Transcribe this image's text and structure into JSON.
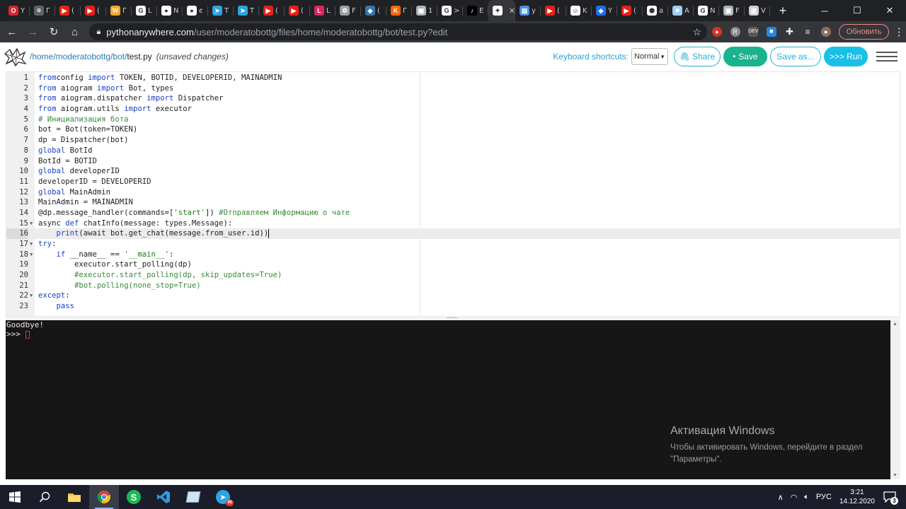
{
  "browser": {
    "tabs": [
      {
        "icon": "opera-icon",
        "color": "#d7262c",
        "glyph": "O",
        "text": "Y"
      },
      {
        "icon": "generic-tab-icon",
        "color": "#5f6368",
        "glyph": "⌾",
        "text": "Г"
      },
      {
        "icon": "youtube-icon",
        "color": "#e62117",
        "glyph": "▶",
        "text": "("
      },
      {
        "icon": "youtube-icon",
        "color": "#e62117",
        "glyph": "▶",
        "text": "("
      },
      {
        "icon": "wix-icon",
        "color": "#f5a623",
        "glyph": "W",
        "text": "Г"
      },
      {
        "icon": "google-icon",
        "color": "#ffffff",
        "glyph": "G",
        "text": "L"
      },
      {
        "icon": "github-icon",
        "color": "#ffffff",
        "glyph": "●",
        "text": "N"
      },
      {
        "icon": "github-icon",
        "color": "#ffffff",
        "glyph": "●",
        "text": "є"
      },
      {
        "icon": "telegram-icon",
        "color": "#2ca5e0",
        "glyph": "➤",
        "text": "T"
      },
      {
        "icon": "telegram-icon",
        "color": "#2ca5e0",
        "glyph": "➤",
        "text": "T"
      },
      {
        "icon": "youtube-icon",
        "color": "#e62117",
        "glyph": "▶",
        "text": "("
      },
      {
        "icon": "youtube-icon",
        "color": "#e62117",
        "glyph": "▶",
        "text": "("
      },
      {
        "icon": "lms-icon",
        "color": "#e0245e",
        "glyph": "L",
        "text": "L"
      },
      {
        "icon": "generic-tab-icon",
        "color": "#9aa0a6",
        "glyph": "⚙",
        "text": "F"
      },
      {
        "icon": "python-icon",
        "color": "#3776ab",
        "glyph": "◆",
        "text": "("
      },
      {
        "icon": "kinopoisk-icon",
        "color": "#ff6600",
        "glyph": "K",
        "text": "Г"
      },
      {
        "icon": "generic-tab-icon",
        "color": "#b0b3b8",
        "glyph": "▣",
        "text": "1"
      },
      {
        "icon": "google-icon",
        "color": "#ffffff",
        "glyph": "G",
        "text": ">"
      },
      {
        "icon": "tiktok-icon",
        "color": "#000000",
        "glyph": "♪",
        "text": "E"
      },
      {
        "icon": "pythonanywhere-icon",
        "color": "#ffffff",
        "glyph": "✦",
        "text": "",
        "active": true,
        "close": "✕"
      },
      {
        "icon": "generic-tab-icon",
        "color": "#4a90e2",
        "glyph": "▤",
        "text": "y"
      },
      {
        "icon": "youtube-icon",
        "color": "#e62117",
        "glyph": "▶",
        "text": "("
      },
      {
        "icon": "generic-tab-icon",
        "color": "#ffffff",
        "glyph": "☺",
        "text": "K"
      },
      {
        "icon": "generic-tab-icon",
        "color": "#1d6ff2",
        "glyph": "◈",
        "text": "Y"
      },
      {
        "icon": "youtube-icon",
        "color": "#e62117",
        "glyph": "▶",
        "text": "("
      },
      {
        "icon": "generic-tab-icon",
        "color": "#ffffff",
        "glyph": "⬢",
        "text": "a"
      },
      {
        "icon": "generic-tab-icon",
        "color": "#9bd0f0",
        "glyph": "✷",
        "text": "A"
      },
      {
        "icon": "google-icon",
        "color": "#ffffff",
        "glyph": "G",
        "text": "N"
      },
      {
        "icon": "generic-tab-icon",
        "color": "#b0b3b8",
        "glyph": "▣",
        "text": "F"
      },
      {
        "icon": "generic-tab-icon",
        "color": "#cfcfcf",
        "glyph": "▥",
        "text": "V"
      }
    ],
    "new_tab": "+",
    "url_host": "pythonanywhere.com",
    "url_path": "/user/moderatobottg/files/home/moderatobottg/bot/test.py?edit",
    "update_button": "Обновить"
  },
  "editor_header": {
    "path_link": "/home/moderatobottg/bot/",
    "file_name": "test.py",
    "unsaved": "(unsaved changes)",
    "keyboard_label": "Keyboard shortcuts:",
    "keyboard_mode": "Normal",
    "share": "Share",
    "save": "Save",
    "save_as": "Save as...",
    "run": ">>> Run"
  },
  "code_lines": [
    {
      "n": "1",
      "tokens": [
        [
          "kw",
          "from"
        ],
        [
          "",
          "config "
        ],
        [
          "kw",
          "import"
        ],
        [
          "",
          " TOKEN, BOTID, DEVELOPERID, MAINADMIN"
        ]
      ]
    },
    {
      "n": "2",
      "tokens": [
        [
          "kw",
          "from"
        ],
        [
          "",
          " aiogram "
        ],
        [
          "kw",
          "import"
        ],
        [
          "",
          " Bot, types"
        ]
      ]
    },
    {
      "n": "3",
      "tokens": [
        [
          "kw",
          "from"
        ],
        [
          "",
          " aiogram.dispatcher "
        ],
        [
          "kw",
          "import"
        ],
        [
          "",
          " Dispatcher"
        ]
      ]
    },
    {
      "n": "4",
      "tokens": [
        [
          "kw",
          "from"
        ],
        [
          "",
          " aiogram.utils "
        ],
        [
          "kw",
          "import"
        ],
        [
          "",
          " executor"
        ]
      ]
    },
    {
      "n": "5",
      "tokens": [
        [
          "cm",
          "# Инициализация бота"
        ]
      ]
    },
    {
      "n": "6",
      "tokens": [
        [
          "",
          "bot = Bot(token=TOKEN)"
        ]
      ]
    },
    {
      "n": "7",
      "tokens": [
        [
          "",
          "dp = Dispatcher(bot)"
        ]
      ]
    },
    {
      "n": "8",
      "tokens": [
        [
          "kw",
          "global"
        ],
        [
          "",
          " BotId"
        ]
      ]
    },
    {
      "n": "9",
      "tokens": [
        [
          "",
          "BotId = BOTID"
        ]
      ]
    },
    {
      "n": "10",
      "tokens": [
        [
          "kw",
          "global"
        ],
        [
          "",
          " developerID"
        ]
      ]
    },
    {
      "n": "11",
      "tokens": [
        [
          "",
          "developerID = DEVELOPERID"
        ]
      ]
    },
    {
      "n": "12",
      "tokens": [
        [
          "kw",
          "global"
        ],
        [
          "",
          " MainAdmin"
        ]
      ]
    },
    {
      "n": "13",
      "tokens": [
        [
          "",
          "MainAdmin = MAINADMIN"
        ]
      ]
    },
    {
      "n": "14",
      "tokens": [
        [
          "",
          "@dp.message_handler(commands=["
        ],
        [
          "str",
          "'start'"
        ],
        [
          "",
          "]) "
        ],
        [
          "cm",
          "#Отправляем Информацию о чате"
        ]
      ]
    },
    {
      "n": "15",
      "fold": true,
      "tokens": [
        [
          "",
          "async "
        ],
        [
          "kw",
          "def"
        ],
        [
          "",
          " chatInfo(message: types.Message):"
        ]
      ]
    },
    {
      "n": "16",
      "active": true,
      "cursor": true,
      "tokens": [
        [
          "",
          "    "
        ],
        [
          "fn",
          "print"
        ],
        [
          "",
          "(await bot.get_chat(message.from_user.id))"
        ]
      ]
    },
    {
      "n": "17",
      "fold": true,
      "tokens": [
        [
          "kw",
          "try"
        ],
        [
          "",
          ":"
        ]
      ]
    },
    {
      "n": "18",
      "fold": true,
      "tokens": [
        [
          "",
          "    "
        ],
        [
          "kw",
          "if"
        ],
        [
          "",
          " __name__ == "
        ],
        [
          "str",
          "'__main__'"
        ],
        [
          "",
          ":"
        ]
      ]
    },
    {
      "n": "19",
      "tokens": [
        [
          "",
          "        executor.start_polling(dp)"
        ]
      ]
    },
    {
      "n": "20",
      "tokens": [
        [
          "",
          "        "
        ],
        [
          "cm",
          "#executor.start_polling(dp, skip_updates=True)"
        ]
      ]
    },
    {
      "n": "21",
      "tokens": [
        [
          "",
          "        "
        ],
        [
          "cm",
          "#bot.polling(none_stop=True)"
        ]
      ]
    },
    {
      "n": "22",
      "fold": true,
      "tokens": [
        [
          "kw",
          "except"
        ],
        [
          "",
          ":"
        ]
      ]
    },
    {
      "n": "23",
      "tokens": [
        [
          "",
          "    "
        ],
        [
          "kw",
          "pass"
        ]
      ]
    }
  ],
  "console": {
    "output_line": "Goodbye!",
    "prompt": ">>> "
  },
  "watermark": {
    "title": "Активация Windows",
    "line1": "Чтобы активировать Windows, перейдите в раздел",
    "line2": "\"Параметры\"."
  },
  "taskbar": {
    "lang": "РУС",
    "time": "3:21",
    "date": "14.12.2020",
    "notifications": "3",
    "telegram_badge": "45"
  },
  "colors": {
    "save_green": "#1bb28e",
    "run_cyan": "#19c0e8",
    "link_blue": "#2aaed8",
    "console_bg": "#161616"
  }
}
